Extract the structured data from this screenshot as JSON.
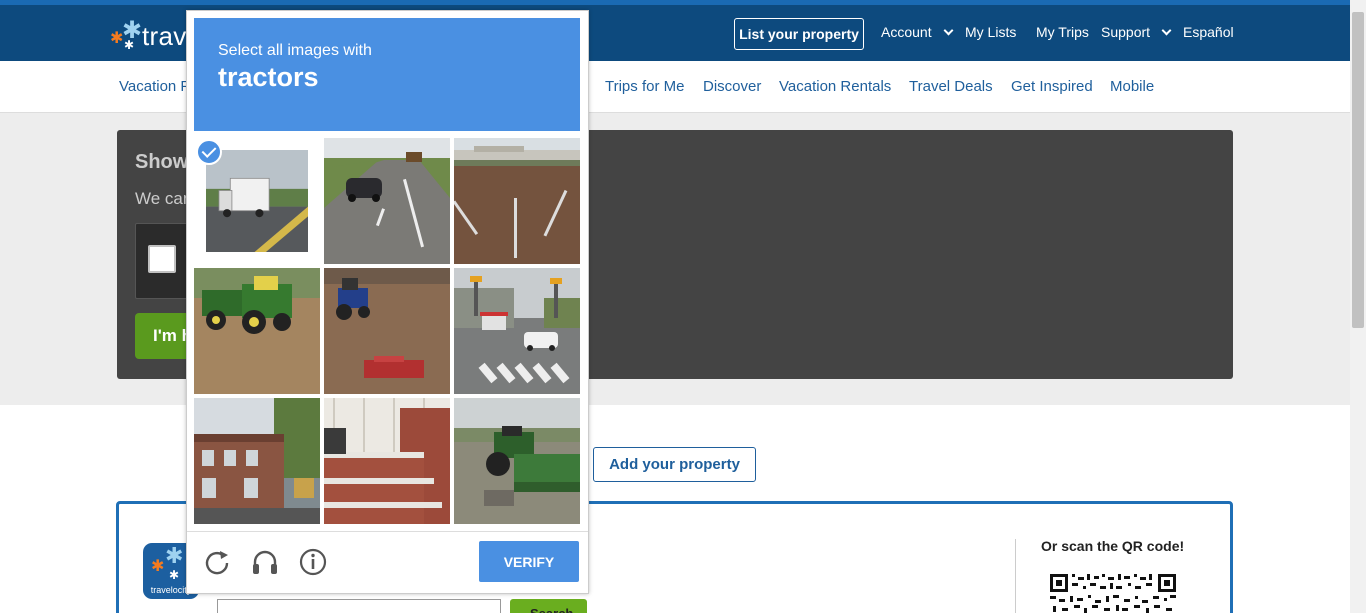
{
  "header": {
    "logo_text": "travelocity",
    "list_property": "List your property",
    "nav": [
      {
        "label": "Account",
        "dropdown": true
      },
      {
        "label": "My Lists",
        "dropdown": false
      },
      {
        "label": "My Trips",
        "dropdown": false
      },
      {
        "label": "Support",
        "dropdown": true
      },
      {
        "label": "Español",
        "dropdown": false
      }
    ]
  },
  "subnav": {
    "items": [
      "Vacation P",
      "Trips for Me",
      "Discover",
      "Vacation Rentals",
      "Travel Deals",
      "Get Inspired",
      "Mobile"
    ]
  },
  "challenge_panel": {
    "title": "Show",
    "subtitle": "We can",
    "button": "I'm h"
  },
  "add_property": "Add your property",
  "app_promo": {
    "icon_text": "travelocity",
    "search_button": "Search",
    "qr_text": "Or scan the QR code!"
  },
  "captcha": {
    "instruction": "Select all images with",
    "target": "tractors",
    "tiles": [
      {
        "content": "white truck on road",
        "selected": true
      },
      {
        "content": "car on highway",
        "selected": false
      },
      {
        "content": "road with overpass",
        "selected": false
      },
      {
        "content": "green tractors in field",
        "selected": false
      },
      {
        "content": "blue tractor in dirt",
        "selected": false
      },
      {
        "content": "intersection with traffic light",
        "selected": false
      },
      {
        "content": "brick buildings on street",
        "selected": false
      },
      {
        "content": "brick steps",
        "selected": false
      },
      {
        "content": "green tractor with equipment",
        "selected": false
      }
    ],
    "reload_icon": "reload-icon",
    "audio_icon": "headphones-icon",
    "info_icon": "info-icon",
    "verify": "VERIFY",
    "accent": "#4a90e2"
  },
  "colors": {
    "header_bg": "#0d4a7e",
    "link": "#1f5f9c",
    "panel_bg": "#444444",
    "green_button": "#5a9a1e"
  }
}
